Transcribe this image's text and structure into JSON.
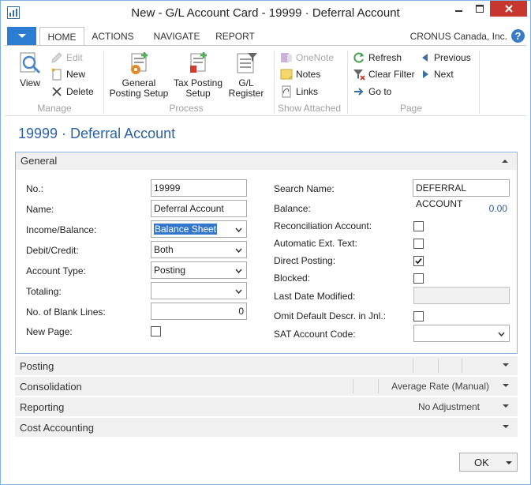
{
  "window": {
    "title": "New - G/L Account Card - 19999 · Deferral Account"
  },
  "ribbon": {
    "tabs": [
      {
        "label": "HOME"
      },
      {
        "label": "ACTIONS"
      },
      {
        "label": "NAVIGATE"
      },
      {
        "label": "REPORT"
      }
    ],
    "company": "CRONUS Canada, Inc.",
    "help": "?",
    "groups": {
      "manage": {
        "label": "Manage",
        "view": "View",
        "edit": "Edit",
        "new": "New",
        "delete": "Delete"
      },
      "process": {
        "label": "Process",
        "general_posting_setup": [
          "General",
          "Posting Setup"
        ],
        "tax_posting_setup": [
          "Tax Posting",
          "Setup"
        ],
        "gl_register": [
          "G/L",
          "Register"
        ]
      },
      "show_attached": {
        "label": "Show Attached",
        "onenote": "OneNote",
        "notes": "Notes",
        "links": "Links"
      },
      "page": {
        "label": "Page",
        "refresh": "Refresh",
        "clear_filter": "Clear Filter",
        "go_to": "Go to",
        "previous": "Previous",
        "next": "Next"
      }
    }
  },
  "page_title": "19999 · Deferral Account",
  "general": {
    "header": "General",
    "left": {
      "no_label": "No.:",
      "no_value": "19999",
      "name_label": "Name:",
      "name_value": "Deferral Account",
      "income_balance_label": "Income/Balance:",
      "income_balance_value": "Balance Sheet",
      "debit_credit_label": "Debit/Credit:",
      "debit_credit_value": "Both",
      "account_type_label": "Account Type:",
      "account_type_value": "Posting",
      "totaling_label": "Totaling:",
      "totaling_value": "",
      "blank_lines_label": "No. of Blank Lines:",
      "blank_lines_value": "0",
      "new_page_label": "New Page:"
    },
    "right": {
      "search_name_label": "Search Name:",
      "search_name_value": "DEFERRAL ACCOUNT",
      "balance_label": "Balance:",
      "balance_value": "0.00",
      "reconciliation_label": "Reconciliation Account:",
      "auto_ext_text_label": "Automatic Ext. Text:",
      "direct_posting_label": "Direct Posting:",
      "blocked_label": "Blocked:",
      "last_date_label": "Last Date Modified:",
      "last_date_value": "",
      "omit_label": "Omit Default Descr. in Jnl.:",
      "sat_label": "SAT Account Code:",
      "sat_value": ""
    },
    "checkboxes": {
      "new_page": false,
      "reconciliation": false,
      "auto_ext_text": false,
      "direct_posting": true,
      "blocked": false,
      "omit": false
    }
  },
  "fasttabs": [
    {
      "label": "Posting",
      "summary": ""
    },
    {
      "label": "Consolidation",
      "summary": "Average Rate (Manual)"
    },
    {
      "label": "Reporting",
      "summary": "No Adjustment"
    },
    {
      "label": "Cost Accounting",
      "summary": ""
    }
  ],
  "footer": {
    "ok": "OK"
  },
  "colors": {
    "accent": "#2b7cd3",
    "title_blue": "#2b63a8",
    "close_red": "#c7372f"
  }
}
